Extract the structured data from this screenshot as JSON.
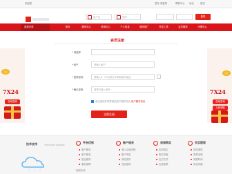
{
  "topbar": {
    "welcome": "欢迎您",
    "links": [
      "您好,请登录",
      "帮助中心",
      "论坛",
      "首页"
    ]
  },
  "header": {
    "search1_placeholder": "用户名",
    "search2_placeholder": "密码",
    "login_label": "登录"
  },
  "nav": {
    "category": "选择分类",
    "items": [
      "首页",
      "服务中心",
      "信用中心",
      "个人信息",
      "服务推广",
      "开发工具",
      "会员服务",
      "代理中心"
    ]
  },
  "form": {
    "title": "会员注册",
    "fields": [
      {
        "label": "请选择",
        "value": "",
        "placeholder": ""
      },
      {
        "label": "帐户",
        "value": "",
        "placeholder": "请输入帐户"
      },
      {
        "label": "登录密码",
        "value": "",
        "placeholder": "请输入6~20位英文字母和数字组合"
      },
      {
        "label": "确认密码",
        "value": "",
        "placeholder": "请再次输入密码"
      }
    ],
    "agree_text": "我已阅读并同意网站用户服务协议",
    "agree_link": "用户服务协议",
    "submit": "立即注册"
  },
  "footer": {
    "support_title": "技术支持",
    "support_sub": "Technical support",
    "columns": [
      {
        "title": "平台优势",
        "links": [
          "账户服务",
          "客户服务",
          "售后服务",
          "服务保障"
        ]
      },
      {
        "title": "账户相关",
        "links": [
          "登入注册流程",
          "账户绑定",
          "修改资料",
          "找回密码"
        ]
      },
      {
        "title": "咨询购买",
        "links": [
          "如何购买",
          "购买流程",
          "支付方式",
          "优惠政策"
        ]
      },
      {
        "title": "交买提现",
        "links": [
          "如何提现",
          "提现流程",
          "到账时间",
          "常见问题"
        ]
      }
    ],
    "hotline": "客服热线"
  },
  "side": {
    "badge": "7X24",
    "tags": [
      "在线咨询",
      "立即领取"
    ]
  },
  "colors": {
    "brand": "#d7151a",
    "accent": "#e2231a",
    "footer_bg": "#f5f5f5"
  }
}
